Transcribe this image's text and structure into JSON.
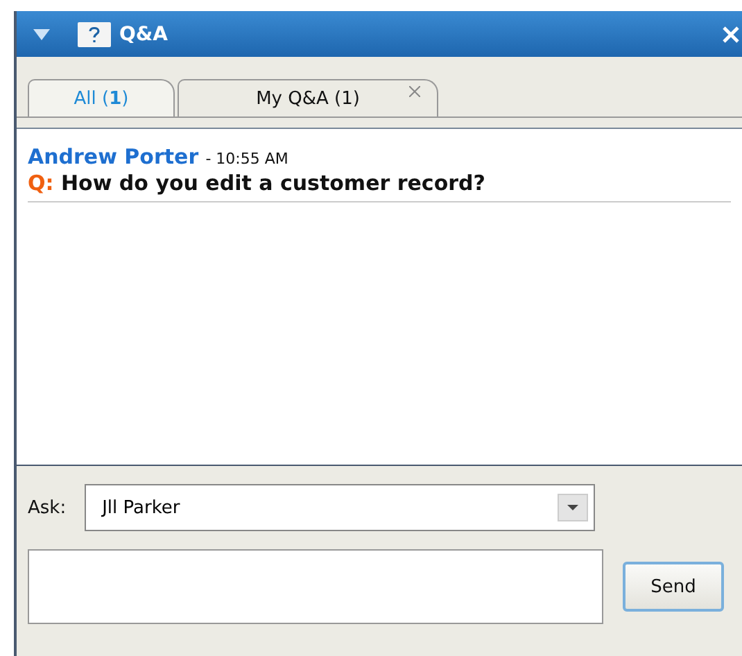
{
  "window": {
    "title": "Q&A"
  },
  "tabs": [
    {
      "label": "All (**1**)",
      "selected": true,
      "closable": false
    },
    {
      "label": "My Q&A (1)",
      "selected": false,
      "closable": true
    }
  ],
  "messages": [
    {
      "author": "Andrew Porter",
      "time": "- 10:55 AM",
      "prefix": "Q:",
      "text": "How do you edit a customer record?"
    }
  ],
  "ask": {
    "label": "Ask:",
    "value": "Jll Parker"
  },
  "send_button": "Send"
}
